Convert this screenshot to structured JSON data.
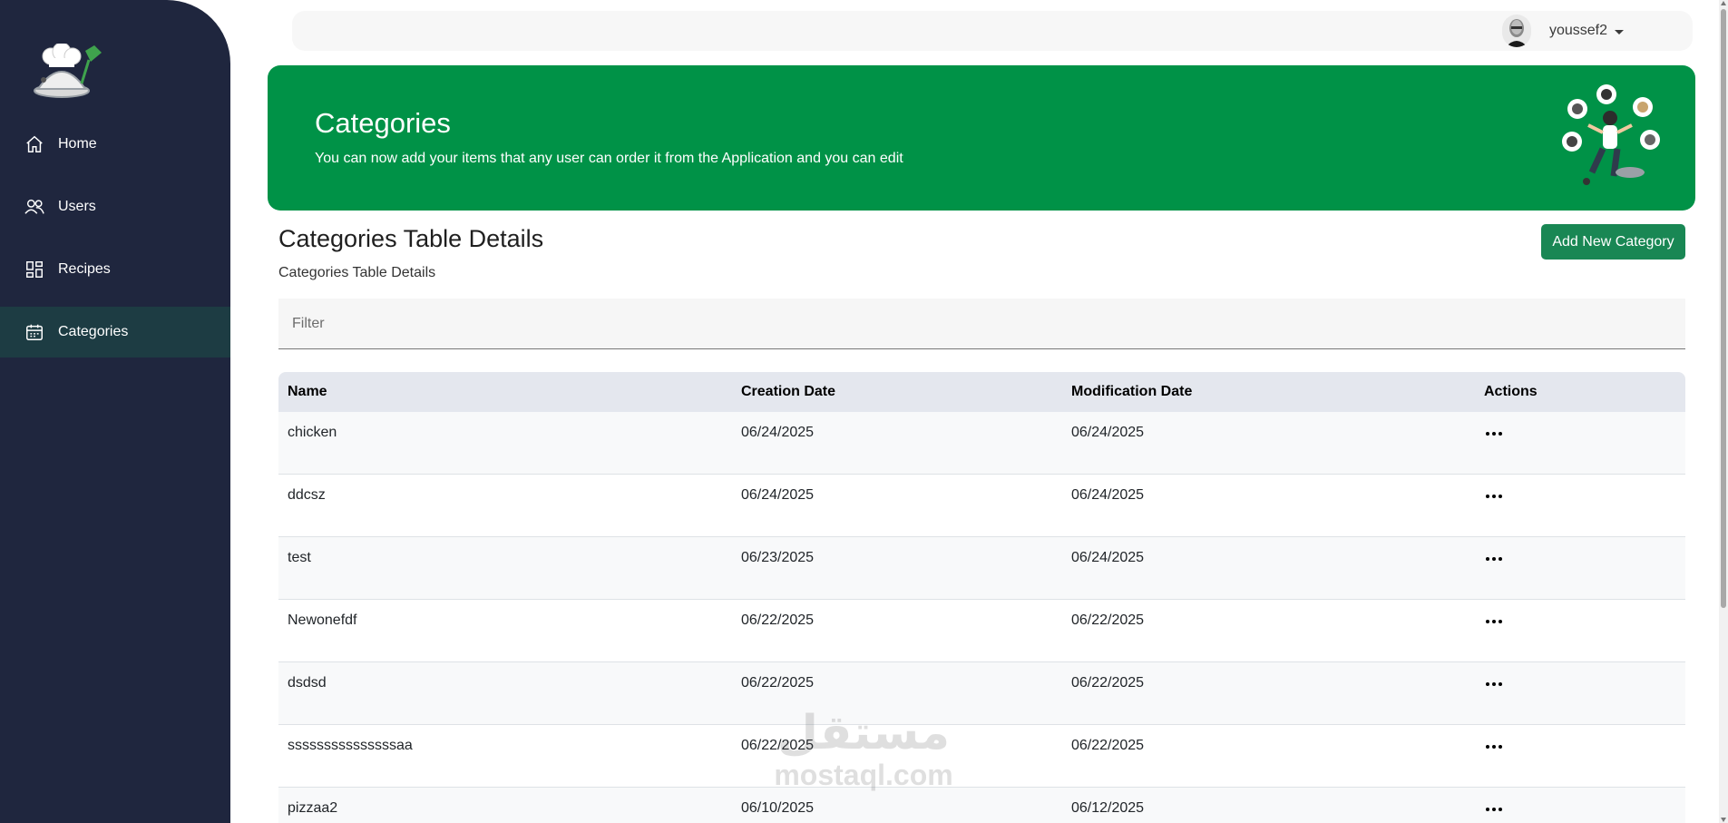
{
  "sidebar": {
    "logo_icon": "chef-hat-cloche-icon",
    "items": [
      {
        "label": "Home",
        "icon": "home-icon",
        "active": false
      },
      {
        "label": "Users",
        "icon": "users-icon",
        "active": false
      },
      {
        "label": "Recipes",
        "icon": "grid-icon",
        "active": false
      },
      {
        "label": "Categories",
        "icon": "calendar-icon",
        "active": true
      }
    ]
  },
  "topbar": {
    "username": "youssef2"
  },
  "banner": {
    "title": "Categories",
    "subtitle": "You can now add your items that any user can order it from the Application and you can edit"
  },
  "section": {
    "title": "Categories Table Details",
    "subtitle": "Categories Table Details",
    "add_button": "Add New Category"
  },
  "filter": {
    "placeholder": "Filter",
    "value": ""
  },
  "table": {
    "headers": [
      "Name",
      "Creation Date",
      "Modification Date",
      "Actions"
    ],
    "rows": [
      {
        "name": "chicken",
        "created": "06/24/2025",
        "modified": "06/24/2025"
      },
      {
        "name": "ddcsz",
        "created": "06/24/2025",
        "modified": "06/24/2025"
      },
      {
        "name": "test",
        "created": "06/23/2025",
        "modified": "06/24/2025"
      },
      {
        "name": "Newonefdf",
        "created": "06/22/2025",
        "modified": "06/22/2025"
      },
      {
        "name": "dsdsd",
        "created": "06/22/2025",
        "modified": "06/22/2025"
      },
      {
        "name": "sssssssssssssssaa",
        "created": "06/22/2025",
        "modified": "06/22/2025"
      },
      {
        "name": "pizzaa2",
        "created": "06/10/2025",
        "modified": "06/12/2025"
      }
    ]
  },
  "watermark": {
    "arabic": "مستقل",
    "latin": "mostaql.com"
  },
  "colors": {
    "sidebar_bg": "#1f263e",
    "sidebar_active": "#1d3c43",
    "banner_green": "#009247",
    "button_green": "#198754",
    "table_header": "#e4e7ee"
  }
}
